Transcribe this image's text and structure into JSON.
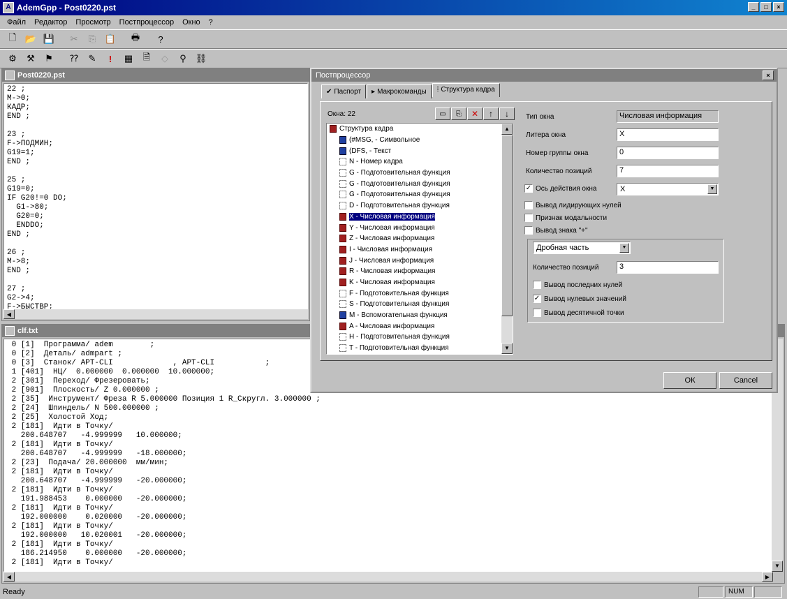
{
  "app": {
    "title": "AdemGpp - Post0220.pst"
  },
  "menu": [
    "Файл",
    "Редактор",
    "Просмотр",
    "Постпроцессор",
    "Окно",
    "?"
  ],
  "editor": {
    "title": "Post0220.pst",
    "lines": [
      "22 ;",
      "M->0;",
      "КАДР;",
      "END ;",
      "",
      "23 ;",
      "F->ПОДМИН;",
      "G19=1;",
      "END ;",
      "",
      "25 ;",
      "G19=0;",
      "IF G20!=0 DO;",
      "  G1->80;",
      "  G20=0;",
      "  ENDDO;",
      "END ;",
      "",
      "26 ;",
      "M->8;",
      "END ;",
      "",
      "27 ;",
      "G2->4;",
      "F->БЫСТВР;"
    ]
  },
  "listing": {
    "title": "clf.txt",
    "lines": [
      " 0 [1]  Программа/ adem        ;",
      " 0 [2]  Деталь/ admpart ;",
      " 0 [3]  Станок/ APT-CLI             , APT-CLI           ;",
      " 1 [401]  НЦ/  0.000000  0.000000  10.000000;",
      " 2 [301]  Переход/ Фрезеровать;",
      " 2 [901]  Плоскость/ Z 0.000000 ;",
      " 2 [35]  Инструмент/ Фреза R 5.000000 Позиция 1 R_Скругл. 3.000000 ;",
      " 2 [24]  Шпиндель/ N 500.000000 ;",
      " 2 [25]  Холостой Ход;",
      " 2 [181]  Идти в Точку/",
      "   200.648707   -4.999999   10.000000;",
      " 2 [181]  Идти в Точку/",
      "   200.648707   -4.999999   -18.000000;",
      " 2 [23]  Подача/ 20.000000  мм/мин;",
      " 2 [181]  Идти в Точку/",
      "   200.648707   -4.999999   -20.000000;",
      " 2 [181]  Идти в Точку/",
      "   191.988453    0.000000   -20.000000;",
      " 2 [181]  Идти в Точку/",
      "   192.000000    0.020000   -20.000000;",
      " 2 [181]  Идти в Точку/",
      "   192.000000   10.020001   -20.000000;",
      " 2 [181]  Идти в Точку/",
      "   186.214950    0.000000   -20.000000;",
      " 2 [181]  Идти в Точку/"
    ]
  },
  "dialog": {
    "title": "Постпроцессор",
    "tabs": [
      "Паспорт",
      "Макрокоманды",
      "Структура кадра"
    ],
    "windows_label": "Окна: 22",
    "tree_root": "Структура кадра",
    "tree_items": [
      {
        "label": "(#MSG, - Символьное",
        "kind": "blue"
      },
      {
        "label": "(DFS, - Текст",
        "kind": "blue"
      },
      {
        "label": "N - Номер кадра",
        "kind": "grey"
      },
      {
        "label": "G - Подготовительная функция",
        "kind": "grey"
      },
      {
        "label": "G - Подготовительная функция",
        "kind": "grey"
      },
      {
        "label": "G - Подготовительная функция",
        "kind": "grey"
      },
      {
        "label": "D - Подготовительная функция",
        "kind": "grey"
      },
      {
        "label": "X - Числовая информация",
        "kind": "red"
      },
      {
        "label": "Y - Числовая информация",
        "kind": "red"
      },
      {
        "label": "Z - Числовая информация",
        "kind": "red"
      },
      {
        "label": "I - Числовая информация",
        "kind": "red"
      },
      {
        "label": "J - Числовая информация",
        "kind": "red"
      },
      {
        "label": "R - Числовая информация",
        "kind": "red"
      },
      {
        "label": "K - Числовая информация",
        "kind": "red"
      },
      {
        "label": "F - Подготовительная функция",
        "kind": "grey"
      },
      {
        "label": "S - Подготовительная функция",
        "kind": "grey"
      },
      {
        "label": "M - Вспомогательная функция",
        "kind": "blue"
      },
      {
        "label": "A - Числовая информация",
        "kind": "red"
      },
      {
        "label": "H - Подготовительная функция",
        "kind": "grey"
      },
      {
        "label": "T - Подготовительная функция",
        "kind": "grey"
      }
    ],
    "fields": {
      "window_type_label": "Тип окна",
      "window_type_value": "Числовая информация",
      "window_letter_label": "Литера окна",
      "window_letter_value": "X",
      "group_number_label": "Номер группы окна",
      "group_number_value": "0",
      "positions_label": "Количество позиций",
      "positions_value": "7",
      "axis_label": "Ось действия окна",
      "axis_value": "X",
      "leading_zeros_label": "Вывод лидирующих нулей",
      "modality_label": "Признак модальности",
      "plus_sign_label": "Вывод знака \"+\"",
      "fraction_value": "Дробная часть",
      "fraction_positions_label": "Количество позиций",
      "fraction_positions_value": "3",
      "trailing_zeros_label": "Вывод последних нулей",
      "zero_values_label": "Вывод нулевых значений",
      "decimal_point_label": "Вывод десятичной точки"
    },
    "ok_label": "ОК",
    "cancel_label": "Cancel"
  },
  "status": {
    "text": "Ready",
    "num": "NUM"
  }
}
